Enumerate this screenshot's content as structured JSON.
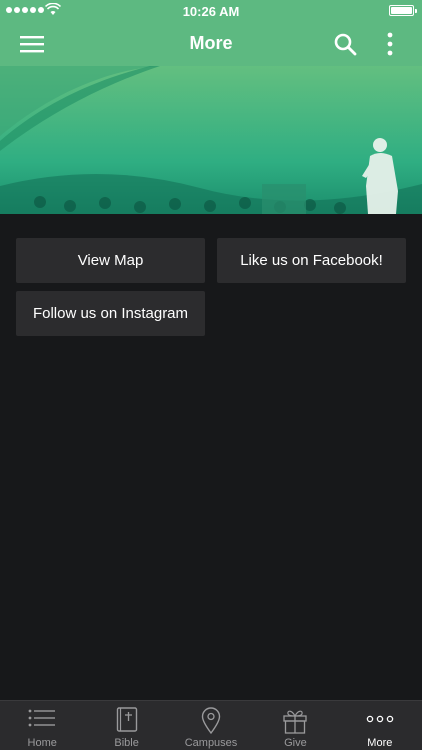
{
  "status": {
    "time": "10:26 AM"
  },
  "header": {
    "title": "More"
  },
  "buttons": {
    "view_map": "View Map",
    "facebook": "Like us on Facebook!",
    "instagram": "Follow us on Instagram"
  },
  "tabs": [
    {
      "label": "Home",
      "icon": "list-icon"
    },
    {
      "label": "Bible",
      "icon": "bible-icon"
    },
    {
      "label": "Campuses",
      "icon": "location-pin-icon"
    },
    {
      "label": "Give",
      "icon": "gift-icon"
    },
    {
      "label": "More",
      "icon": "more-dots-icon",
      "active": true
    }
  ],
  "colors": {
    "header_bg": "#5db981",
    "page_bg": "#17181a",
    "button_bg": "#2c2c2e",
    "tabbar_bg": "#2b2b2d"
  }
}
